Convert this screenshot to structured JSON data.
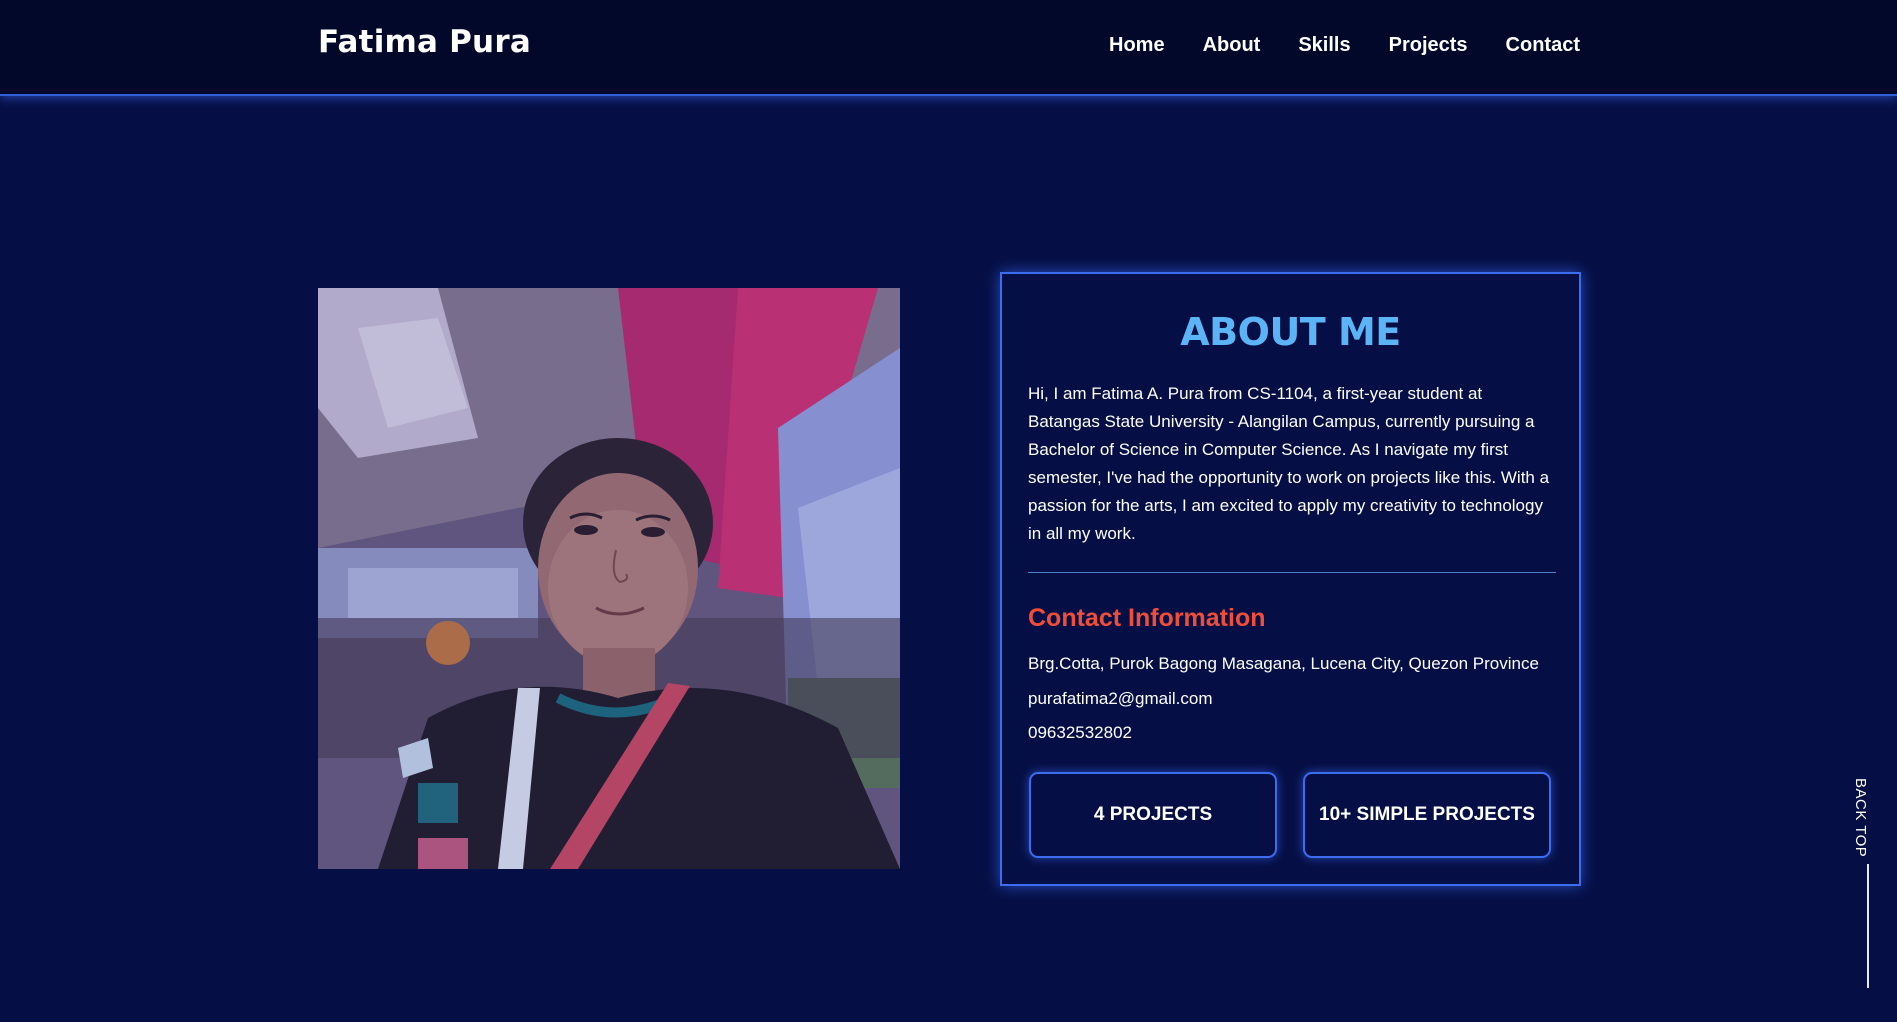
{
  "header": {
    "brand": "Fatima Pura",
    "nav": [
      "Home",
      "About",
      "Skills",
      "Projects",
      "Contact"
    ]
  },
  "about": {
    "title": "ABOUT ME",
    "bio": "Hi, I am Fatima A. Pura from CS-1104, a first-year student at Batangas State University - Alangilan Campus, currently pursuing a Bachelor of Science in Computer Science. As I navigate my first semester, I've had the opportunity to work on projects like this. With a passion for the arts, I am excited to apply my creativity to technology in all my work.",
    "contact_heading": "Contact Information",
    "address": "Brg.Cotta, Purok Bagong Masagana, Lucena City, Quezon Province",
    "email": "purafatima2@gmail.com",
    "phone": "09632532802",
    "stats": [
      "4 PROJECTS",
      "10+ SIMPLE PROJECTS"
    ]
  },
  "back_top": "BACK TOP",
  "colors": {
    "background": "#060f45",
    "header": "#02082a",
    "accent_blue": "#3c6cf0",
    "title_blue": "#5bb4f5",
    "contact_red": "#f04e3a"
  }
}
